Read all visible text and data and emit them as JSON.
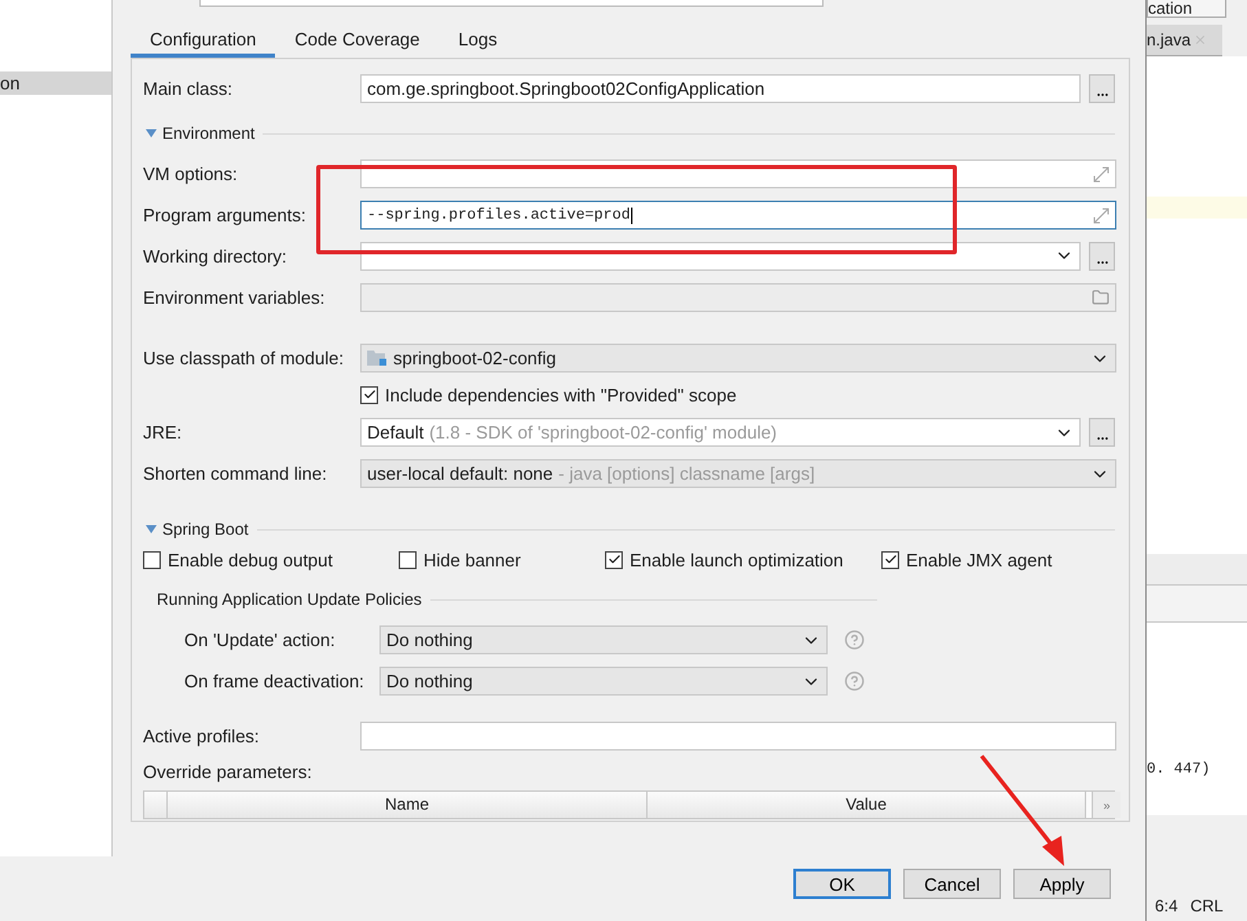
{
  "sidebar": {
    "items": [
      {
        "label": "on",
        "selected": true
      }
    ]
  },
  "tabs": [
    {
      "label": "Configuration",
      "selected": true
    },
    {
      "label": "Code Coverage",
      "selected": false
    },
    {
      "label": "Logs",
      "selected": false
    }
  ],
  "main_class": {
    "label": "Main class:",
    "value": "com.ge.springboot.Springboot02ConfigApplication"
  },
  "environment": {
    "title": "Environment",
    "expanded": true,
    "fields": [
      {
        "kind": "expand",
        "label": "VM options:"
      },
      {
        "kind": "expand",
        "label": "Program arguments:",
        "value": "--spring.profiles.active=prod",
        "focused": true
      },
      {
        "kind": "combo",
        "label": "Working directory:"
      },
      {
        "kind": "browse",
        "label": "Environment variables:"
      }
    ]
  },
  "module": {
    "label": "Use classpath of module:",
    "value": "springboot-02-config"
  },
  "include_deps": {
    "label": "Include dependencies with \"Provided\" scope",
    "checked": true
  },
  "jre": {
    "label": "JRE:",
    "value": "Default",
    "detail": "(1.8 - SDK of 'springboot-02-config' module)"
  },
  "shorten": {
    "label": "Shorten command line:",
    "value": "user-local default: none",
    "detail": "- java [options] classname [args]"
  },
  "spring_boot": {
    "title": "Spring Boot",
    "expanded": true,
    "options": [
      {
        "label": "Enable debug output",
        "checked": false
      },
      {
        "label": "Hide banner",
        "checked": false
      },
      {
        "label": "Enable launch optimization",
        "checked": true
      },
      {
        "label": "Enable JMX agent",
        "checked": true
      }
    ],
    "policies": {
      "title": "Running Application Update Policies",
      "rows": [
        {
          "label": "On 'Update' action:",
          "value": "Do nothing"
        },
        {
          "label": "On frame deactivation:",
          "value": "Do nothing"
        }
      ]
    }
  },
  "active_profiles": {
    "label": "Active profiles:"
  },
  "override": {
    "label": "Override parameters:",
    "columns": [
      "Name",
      "Value"
    ],
    "more": "»"
  },
  "buttons": [
    {
      "label": "OK",
      "default": true
    },
    {
      "label": "Cancel",
      "default": false
    },
    {
      "label": "Apply",
      "default": false
    }
  ],
  "ide": {
    "run_config": "cation",
    "editor_tab": "n.java",
    "console_text": "0. 447)",
    "status": [
      "6:4",
      "CRL"
    ]
  }
}
